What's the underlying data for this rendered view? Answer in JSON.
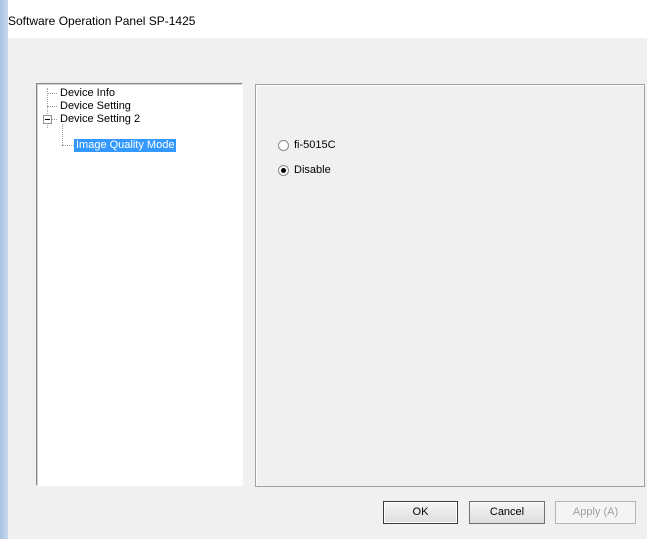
{
  "window": {
    "title": "Software Operation Panel SP-1425"
  },
  "tree": {
    "items": [
      {
        "label": "Device Info"
      },
      {
        "label": "Device Setting"
      },
      {
        "label": "Device Setting 2"
      },
      {
        "label": "Image Quality Mode",
        "selected": true
      }
    ]
  },
  "options": {
    "radios": [
      {
        "label": "fi-5015C",
        "checked": false
      },
      {
        "label": "Disable",
        "checked": true
      }
    ]
  },
  "buttons": {
    "ok": "OK",
    "cancel": "Cancel",
    "apply": "Apply (A)"
  },
  "colors": {
    "selection": "#3399ff",
    "dialog_bg": "#f0f0f0"
  }
}
